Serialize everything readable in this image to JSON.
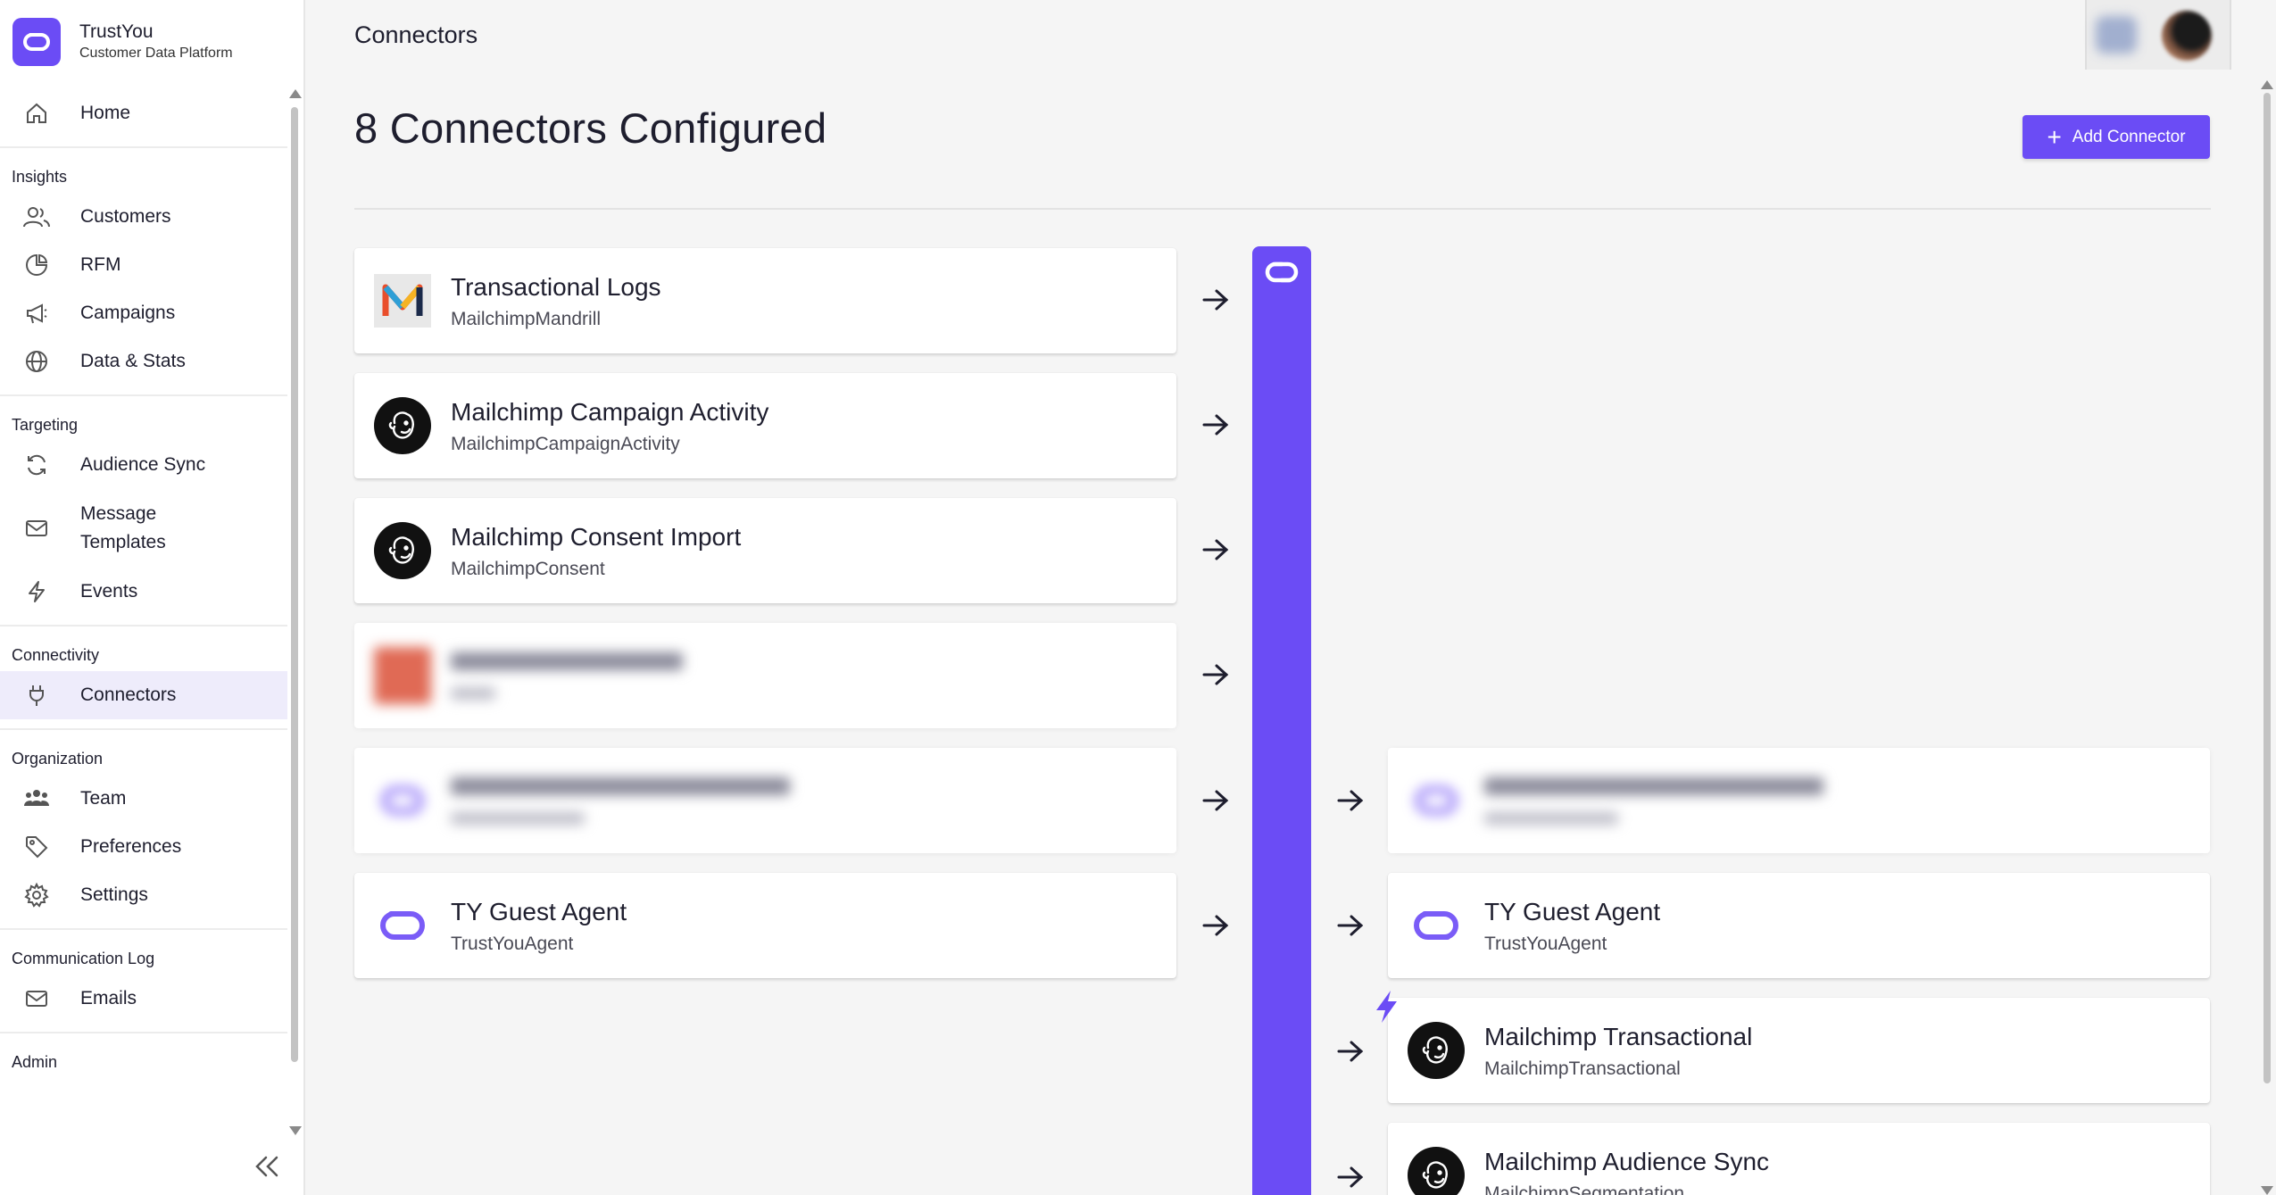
{
  "brand": {
    "name": "TrustYou",
    "subtitle": "Customer Data Platform"
  },
  "sidebar": {
    "home": "Home",
    "sections": [
      {
        "title": "Insights",
        "items": [
          "Customers",
          "RFM",
          "Campaigns",
          "Data & Stats"
        ]
      },
      {
        "title": "Targeting",
        "items": [
          "Audience Sync",
          "Message Templates",
          "Events"
        ]
      },
      {
        "title": "Connectivity",
        "items": [
          "Connectors"
        ]
      },
      {
        "title": "Organization",
        "items": [
          "Team",
          "Preferences",
          "Settings"
        ]
      },
      {
        "title": "Communication Log",
        "items": [
          "Emails"
        ]
      },
      {
        "title": "Admin",
        "items": []
      }
    ],
    "active_item": "Connectors"
  },
  "header": {
    "breadcrumb": "Connectors"
  },
  "page": {
    "title": "8 Connectors Configured",
    "add_button_label": "Add Connector"
  },
  "sources": [
    {
      "title": "Transactional Logs",
      "type": "MailchimpMandrill",
      "logo": "mandrill-logo"
    },
    {
      "title": "Mailchimp Campaign Activity",
      "type": "MailchimpCampaignActivity",
      "logo": "mailchimp-logo"
    },
    {
      "title": "Mailchimp Consent Import",
      "type": "MailchimpConsent",
      "logo": "mailchimp-logo"
    },
    {
      "title": "",
      "type": "",
      "logo": "blurred-logo",
      "blurred": true
    },
    {
      "title": "",
      "type": "",
      "logo": "trustyou-logo",
      "blurred": true
    },
    {
      "title": "TY Guest Agent",
      "type": "TrustYouAgent",
      "logo": "trustyou-logo"
    }
  ],
  "destinations": [
    {
      "title": "",
      "type": "",
      "logo": "trustyou-logo",
      "blurred": true
    },
    {
      "title": "TY Guest Agent",
      "type": "TrustYouAgent",
      "logo": "trustyou-logo"
    },
    {
      "title": "Mailchimp Transactional",
      "type": "MailchimpTransactional",
      "logo": "mailchimp-logo"
    },
    {
      "title": "Mailchimp Audience Sync",
      "type": "MailchimpSegmentation",
      "logo": "mailchimp-logo"
    }
  ],
  "colors": {
    "accent": "#6b4cf5",
    "active_nav_bg": "#eeecfb",
    "background": "#f5f5f5"
  }
}
